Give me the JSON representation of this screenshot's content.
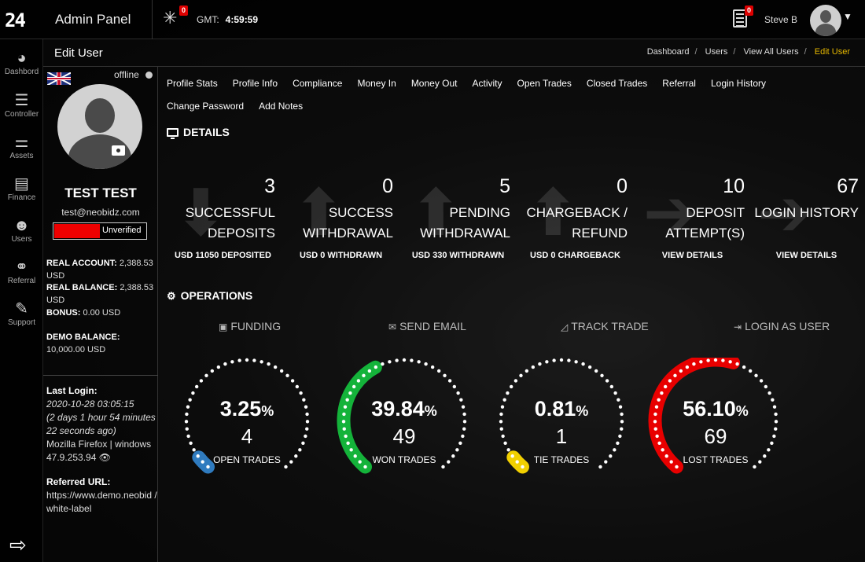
{
  "topbar": {
    "logo": "24",
    "app_title": "Admin Panel",
    "notification_count": "0",
    "gmt_label": "GMT:",
    "gmt_time": "4:59:59",
    "docs_count": "0",
    "user_name": "Steve B"
  },
  "sidebar": {
    "items": [
      {
        "label": "Dashbord",
        "icon": "dashboard-icon"
      },
      {
        "label": "Controller",
        "icon": "controller-icon"
      },
      {
        "label": "Assets",
        "icon": "sliders-icon"
      },
      {
        "label": "Finance",
        "icon": "credit-card-icon"
      },
      {
        "label": "Users",
        "icon": "add-user-icon"
      },
      {
        "label": "Referral",
        "icon": "handshake-icon"
      },
      {
        "label": "Support",
        "icon": "ticket-icon"
      }
    ]
  },
  "subheader": {
    "title": "Edit User",
    "breadcrumbs": [
      "Dashboard",
      "Users",
      "View All Users",
      "Edit User"
    ]
  },
  "profile": {
    "status": "offline",
    "name": "TEST TEST",
    "email": "test@neobidz.com",
    "verification": "Unverified",
    "real_account_label": "REAL ACCOUNT:",
    "real_account_value": "2,388.53 USD",
    "real_balance_label": "REAL BALANCE:",
    "real_balance_value": "2,388.53 USD",
    "bonus_label": "BONUS:",
    "bonus_value": "0.00 USD",
    "demo_balance_label": "DEMO BALANCE:",
    "demo_balance_value": "10,000.00 USD",
    "last_login_label": "Last Login:",
    "last_login_date": "2020-10-28 03:05:15",
    "last_login_ago": "(2 days 1 hour 54 minutes 22 seconds ago)",
    "browser": "Mozilla Firefox | windows",
    "ip": "47.9.253.94",
    "referred_label": "Referred URL:",
    "referred_url": "https://www.demo.neobid /white-label"
  },
  "tabs": [
    "Profile Stats",
    "Profile Info",
    "Compliance",
    "Money In",
    "Money Out",
    "Activity",
    "Open Trades",
    "Closed Trades",
    "Referral",
    "Login History",
    "Change Password",
    "Add Notes"
  ],
  "details": {
    "title": "DETAILS",
    "stats": [
      {
        "value": "3",
        "label": "SUCCESSFUL DEPOSITS",
        "sub": "USD 11050 DEPOSITED"
      },
      {
        "value": "0",
        "label": "SUCCESS WITHDRAWAL",
        "sub": "USD 0 WITHDRAWN"
      },
      {
        "value": "5",
        "label": "PENDING WITHDRAWAL",
        "sub": "USD 330 WITHDRAWN"
      },
      {
        "value": "0",
        "label": "CHARGEBACK / REFUND",
        "sub": "USD 0 CHARGEBACK"
      },
      {
        "value": "10",
        "label": "DEPOSIT ATTEMPT(S)",
        "sub": "VIEW DETAILS"
      },
      {
        "value": "67",
        "label": "LOGIN HISTORY",
        "sub": "VIEW DETAILS"
      }
    ]
  },
  "operations": {
    "title": "OPERATIONS",
    "actions": [
      "FUNDING",
      "SEND EMAIL",
      "TRACK TRADE",
      "LOGIN AS USER"
    ]
  },
  "gauges": [
    {
      "percent": "3.25",
      "count": "4",
      "caption": "OPEN TRADES",
      "color": "#2f7bbf",
      "fraction": 0.0325
    },
    {
      "percent": "39.84",
      "count": "49",
      "caption": "WON TRADES",
      "color": "#14b33a",
      "fraction": 0.3984
    },
    {
      "percent": "0.81",
      "count": "1",
      "caption": "TIE TRADES",
      "color": "#f2d000",
      "fraction": 0.0081
    },
    {
      "percent": "56.10",
      "count": "69",
      "caption": "LOST TRADES",
      "color": "#e80000",
      "fraction": 0.561
    }
  ]
}
